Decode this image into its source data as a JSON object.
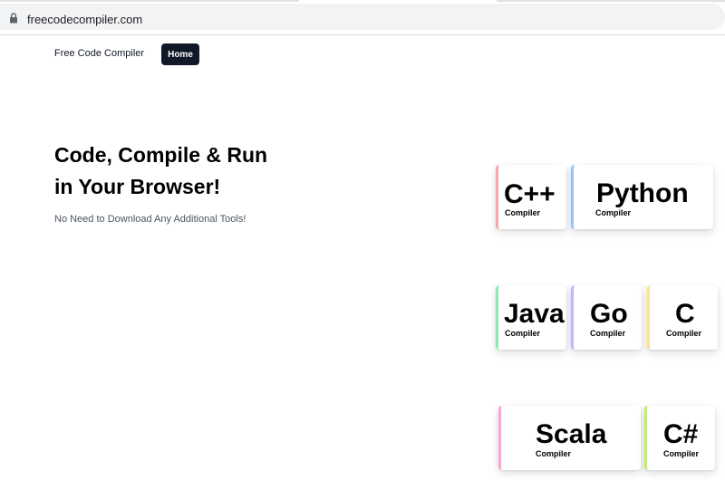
{
  "browser": {
    "url": "freecodecompiler.com"
  },
  "nav": {
    "brand": "Free Code Compiler",
    "home_label": "Home"
  },
  "hero": {
    "title_line1": "Code, Compile & Run",
    "title_line2": "in Your Browser!",
    "subtitle": "No Need to Download Any Additional Tools!"
  },
  "compilers": [
    {
      "name": "C++",
      "label": "Compiler",
      "accent": "#fca5a5"
    },
    {
      "name": "Python",
      "label": "Compiler",
      "accent": "#93c5fd"
    },
    {
      "name": "Java",
      "label": "Compiler",
      "accent": "#86efac"
    },
    {
      "name": "Go",
      "label": "Compiler",
      "accent": "#c4b5fd"
    },
    {
      "name": "C",
      "label": "Compiler",
      "accent": "#fde68a"
    },
    {
      "name": "Scala",
      "label": "Compiler",
      "accent": "#f9a8d4"
    },
    {
      "name": "C#",
      "label": "Compiler",
      "accent": "#bef264"
    }
  ],
  "colors": {
    "primary_dark": "#111827",
    "muted_text": "#4b5563"
  },
  "icons": {
    "address_bar": "lock-icon"
  }
}
